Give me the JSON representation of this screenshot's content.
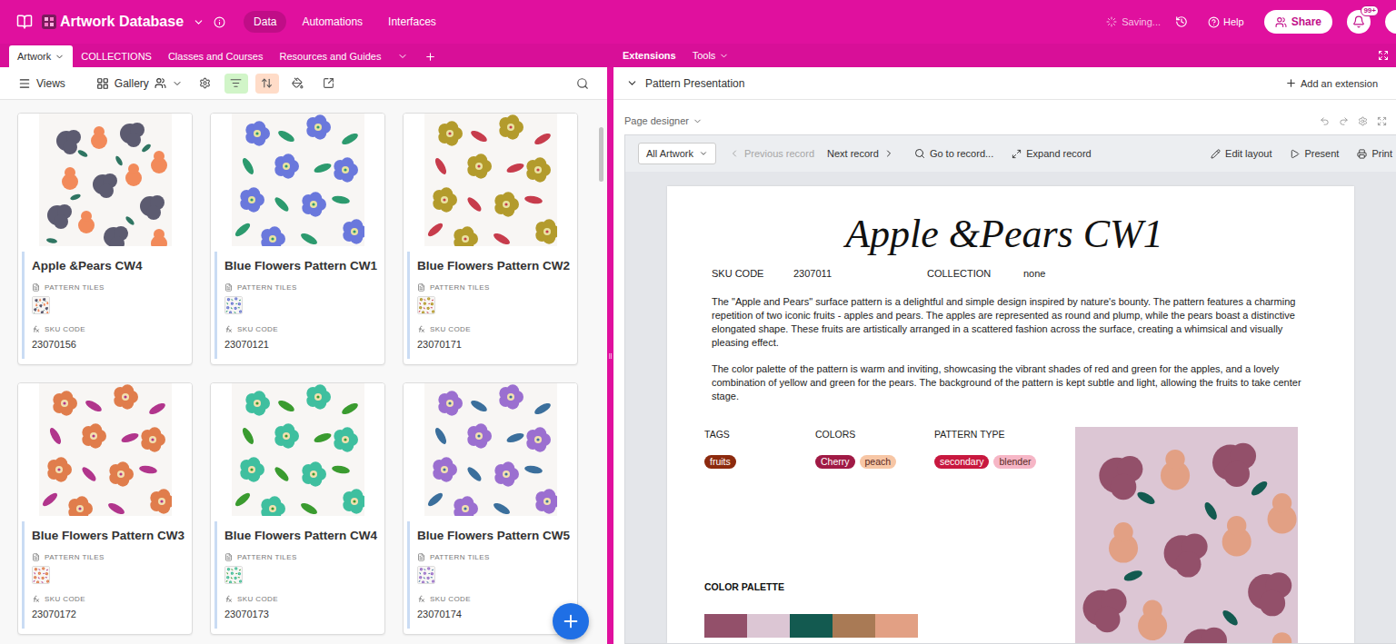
{
  "app": {
    "title": "Artwork Database",
    "nav": [
      {
        "label": "Data",
        "selected": true
      },
      {
        "label": "Automations",
        "selected": false
      },
      {
        "label": "Interfaces",
        "selected": false
      }
    ],
    "status": "Saving...",
    "help": "Help",
    "share": "Share",
    "notifications": "99+"
  },
  "tabs": [
    {
      "label": "Artwork",
      "selected": true
    },
    {
      "label": "COLLECTIONS",
      "selected": false
    },
    {
      "label": "Classes and Courses",
      "selected": false
    },
    {
      "label": "Resources and Guides",
      "selected": false
    }
  ],
  "side_tabs": [
    {
      "label": "Extensions",
      "selected": true
    },
    {
      "label": "Tools",
      "selected": false
    }
  ],
  "toolbar": {
    "views": "Views",
    "view_name": "Gallery",
    "filter_active": true,
    "sort_active": true
  },
  "gallery": {
    "cards": [
      {
        "name": "Apple &Pears CW4",
        "tiles_label": "PATTERN TILES",
        "sku_label": "SKU CODE",
        "sku": "23070156",
        "kind": "fruit",
        "colors": [
          "#5c5b70",
          "#f28a5a",
          "#2f7562"
        ]
      },
      {
        "name": "Blue Flowers Pattern CW1",
        "tiles_label": "PATTERN TILES",
        "sku_label": "SKU CODE",
        "sku": "23070121",
        "kind": "flower",
        "colors": [
          "#6a78dc",
          "#2c9a6e",
          "#e9e3a0"
        ]
      },
      {
        "name": "Blue Flowers Pattern CW2",
        "tiles_label": "PATTERN TILES",
        "sku_label": "SKU CODE",
        "sku": "23070171",
        "kind": "flower",
        "colors": [
          "#b39b2c",
          "#c73c4c",
          "#e9e3a0"
        ]
      },
      {
        "name": "Blue Flowers Pattern CW3",
        "tiles_label": "PATTERN TILES",
        "sku_label": "SKU CODE",
        "sku": "23070172",
        "kind": "flower",
        "colors": [
          "#e07d4c",
          "#b1358c",
          "#f2e0b0"
        ]
      },
      {
        "name": "Blue Flowers Pattern CW4",
        "tiles_label": "PATTERN TILES",
        "sku_label": "SKU CODE",
        "sku": "23070173",
        "kind": "flower",
        "colors": [
          "#3fbf9f",
          "#3a9b2f",
          "#f2e0b0"
        ]
      },
      {
        "name": "Blue Flowers Pattern CW5",
        "tiles_label": "PATTERN TILES",
        "sku_label": "SKU CODE",
        "sku": "23070174",
        "kind": "flower",
        "colors": [
          "#9b6fd0",
          "#3b6f9c",
          "#f2e0b0"
        ]
      }
    ]
  },
  "extension": {
    "name": "Pattern Presentation",
    "add": "Add an extension",
    "mode": "Page designer",
    "toolbar": {
      "view": "All Artwork",
      "previous": {
        "label": "Previous record",
        "disabled": true
      },
      "next": "Next record",
      "goto": "Go to record...",
      "expand": "Expand record",
      "edit": "Edit layout",
      "present": "Present",
      "print": "Print"
    }
  },
  "page": {
    "title": "Apple &Pears CW1",
    "fields": [
      {
        "label": "SKU CODE",
        "value": "2307011"
      },
      {
        "label": "COLLECTION",
        "value": "none"
      }
    ],
    "description": [
      "The \"Apple and Pears\" surface pattern is a delightful and simple design inspired by nature's bounty. The pattern features a charming repetition of two iconic fruits - apples and pears. The apples are represented as round and plump, while the pears boast a distinctive elongated shape. These fruits are artistically arranged in a scattered fashion across the surface, creating a whimsical and visually pleasing effect.",
      "The color palette of the pattern is warm and inviting, showcasing the vibrant shades of red and green for the apples, and a lovely combination of yellow and green for the pears. The background of the pattern is kept subtle and light, allowing the fruits to take center stage."
    ],
    "groups": [
      {
        "label": "TAGS",
        "pills": [
          {
            "text": "fruits",
            "color": "#8c2a0e"
          }
        ]
      },
      {
        "label": "COLORS",
        "pills": [
          {
            "text": "Cherry",
            "color": "#a01a45"
          },
          {
            "text": "peach",
            "color": "#f7c6a5"
          }
        ]
      },
      {
        "label": "PATTERN TYPE",
        "pills": [
          {
            "text": "secondary",
            "color": "#c8183f"
          },
          {
            "text": "blender",
            "color": "#f6b6c6"
          }
        ]
      }
    ],
    "palette_label": "COLOR PALETTE",
    "palette": [
      {
        "color": "#93506a"
      },
      {
        "color": "#dcc6d4"
      },
      {
        "color": "#135a50"
      },
      {
        "color": "#a97a55"
      },
      {
        "color": "#e2a084"
      }
    ]
  }
}
